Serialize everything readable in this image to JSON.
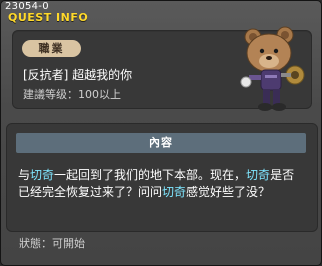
{
  "window": {
    "quest_id": "23054-0",
    "title": "QUEST INFO"
  },
  "header": {
    "job_badge": "職業",
    "quest_name": "[反抗者] 超越我的你",
    "recommended_level": "建議等级：100以上"
  },
  "content": {
    "heading": "內容",
    "text_parts": [
      "与",
      "切奇",
      "一起回到了我们的地下本部。现在，",
      "切奇",
      "是否已经完全恢复过来了？问问",
      "切奇",
      "感觉好些了没？"
    ]
  },
  "footer": {
    "status": "狀態：可開始"
  },
  "colors": {
    "title": "#ffd92a",
    "highlight": "#7fe6ff",
    "badge": "#d9c4a2",
    "content_header": "#5d6e7b"
  },
  "npc": {
    "icon": "bear-npc-icon"
  }
}
